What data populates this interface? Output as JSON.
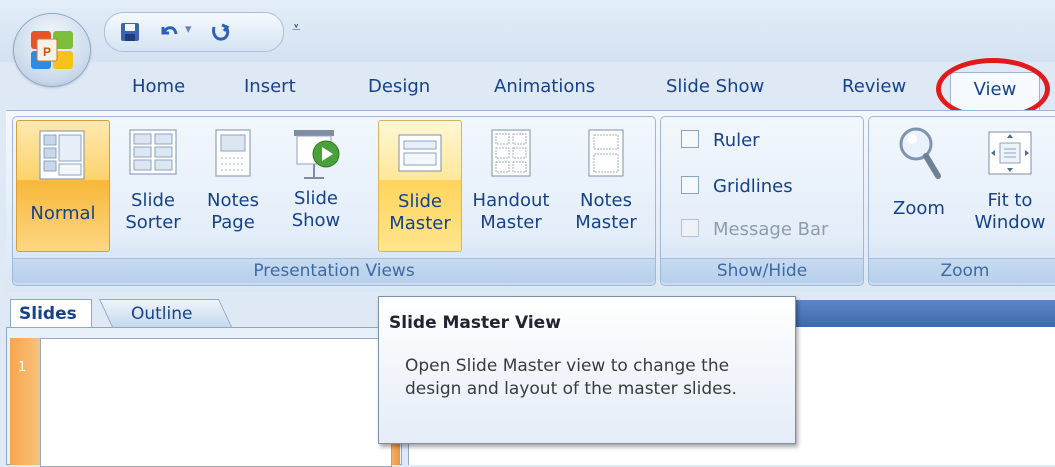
{
  "quick_access": {
    "icons": [
      "save-icon",
      "undo-icon",
      "redo-icon",
      "customize-quick-access-icon"
    ],
    "undo_dropdown": "▾",
    "more": "⩡"
  },
  "tabs": [
    "Home",
    "Insert",
    "Design",
    "Animations",
    "Slide Show",
    "Review",
    "View"
  ],
  "active_tab": "View",
  "ribbon": {
    "presentation_views": {
      "label": "Presentation Views",
      "buttons": [
        {
          "line1": "Normal",
          "line2": "",
          "state": "active"
        },
        {
          "line1": "Slide",
          "line2": "Sorter"
        },
        {
          "line1": "Notes",
          "line2": "Page"
        },
        {
          "line1": "Slide",
          "line2": "Show"
        },
        {
          "line1": "Slide",
          "line2": "Master",
          "state": "hover"
        },
        {
          "line1": "Handout",
          "line2": "Master"
        },
        {
          "line1": "Notes",
          "line2": "Master"
        }
      ]
    },
    "show_hide": {
      "label": "Show/Hide",
      "checkboxes": [
        {
          "label": "Ruler",
          "checked": false
        },
        {
          "label": "Gridlines",
          "checked": false
        },
        {
          "label": "Message Bar",
          "checked": false,
          "disabled": true
        }
      ]
    },
    "zoom": {
      "label": "Zoom",
      "buttons": [
        {
          "line1": "Zoom",
          "line2": ""
        },
        {
          "line1": "Fit to",
          "line2": "Window"
        }
      ]
    }
  },
  "pane_tabs": [
    "Slides",
    "Outline"
  ],
  "slide_number": "1",
  "tooltip": {
    "title": "Slide Master View",
    "body": "Open Slide Master view to change the design and layout of the master slides."
  },
  "colors": {
    "highlight_circle": "#e21a1a",
    "ribbon_text": "#15428b",
    "active_button": "#fcd36b"
  }
}
